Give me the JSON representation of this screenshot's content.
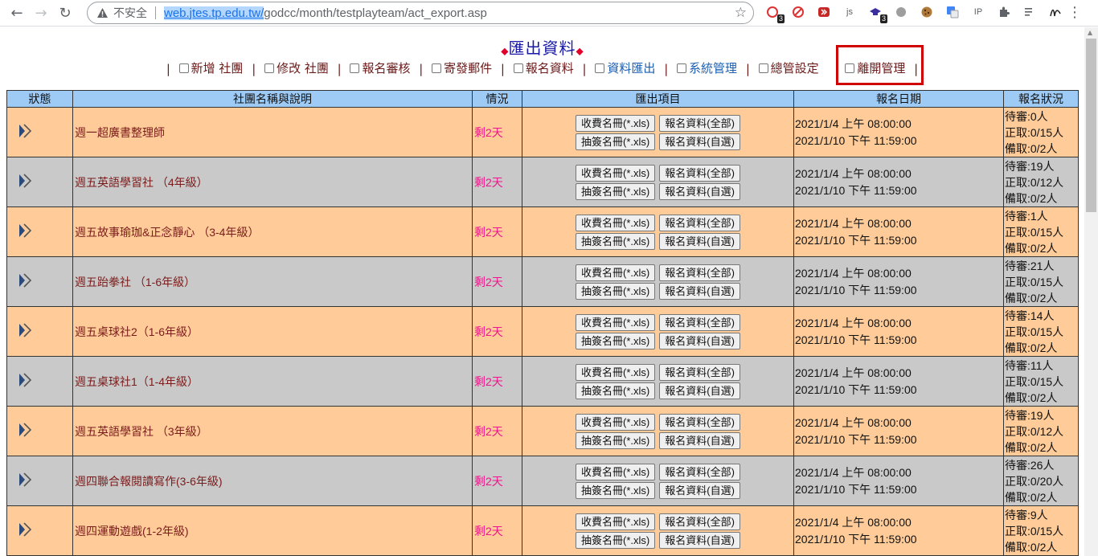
{
  "browser": {
    "insecure_label": "不安全",
    "url_host": "web.jtes.tp.edu.tw/",
    "url_path": "godcc/month/testplayteam/act_export.asp",
    "ext_badge_1": "3",
    "ext_badge_2": "3",
    "ext_js": "js",
    "ext_ip": "IP"
  },
  "page": {
    "title": "匯出資料"
  },
  "menu": [
    {
      "label": "新增 社團",
      "link": false
    },
    {
      "label": "修改 社團",
      "link": false
    },
    {
      "label": "報名審核",
      "link": false
    },
    {
      "label": "寄發郵件",
      "link": false
    },
    {
      "label": "報名資料",
      "link": false
    },
    {
      "label": "資料匯出",
      "link": true
    },
    {
      "label": "系統管理",
      "link": true
    },
    {
      "label": "總管設定",
      "link": false
    },
    {
      "label": "離開管理",
      "link": false
    }
  ],
  "table": {
    "headers": [
      "狀態",
      "社團名稱與說明",
      "情況",
      "匯出項目",
      "報名日期",
      "報名狀況"
    ],
    "buttons": {
      "fee_list": "收費名冊(*.xls)",
      "lottery_list": "抽簽名冊(*.xls)",
      "signup_all": "報名資料(全部)",
      "signup_pick": "報名資料(自選)"
    },
    "rows": [
      {
        "name": "週一超廣書整理師",
        "remain": "剩2天",
        "start": "2021/1/4 上午 08:00:00",
        "end": "2021/1/10 下午 11:59:00",
        "pending": "待審:0人",
        "admitted": "正取:0/15人",
        "waitlist": "備取:0/2人"
      },
      {
        "name": "週五英語學習社 （4年級）",
        "remain": "剩2天",
        "start": "2021/1/4 上午 08:00:00",
        "end": "2021/1/10 下午 11:59:00",
        "pending": "待審:19人",
        "admitted": "正取:0/12人",
        "waitlist": "備取:0/2人"
      },
      {
        "name": "週五故事瑜珈&正念靜心 （3-4年級）",
        "remain": "剩2天",
        "start": "2021/1/4 上午 08:00:00",
        "end": "2021/1/10 下午 11:59:00",
        "pending": "待審:1人",
        "admitted": "正取:0/15人",
        "waitlist": "備取:0/2人"
      },
      {
        "name": "週五跆拳社 （1-6年級）",
        "remain": "剩2天",
        "start": "2021/1/4 上午 08:00:00",
        "end": "2021/1/10 下午 11:59:00",
        "pending": "待審:21人",
        "admitted": "正取:0/15人",
        "waitlist": "備取:0/2人"
      },
      {
        "name": "週五桌球社2（1-6年級）",
        "remain": "剩2天",
        "start": "2021/1/4 上午 08:00:00",
        "end": "2021/1/10 下午 11:59:00",
        "pending": "待審:14人",
        "admitted": "正取:0/15人",
        "waitlist": "備取:0/2人"
      },
      {
        "name": "週五桌球社1（1-4年級）",
        "remain": "剩2天",
        "start": "2021/1/4 上午 08:00:00",
        "end": "2021/1/10 下午 11:59:00",
        "pending": "待審:11人",
        "admitted": "正取:0/15人",
        "waitlist": "備取:0/2人"
      },
      {
        "name": "週五英語學習社 （3年級）",
        "remain": "剩2天",
        "start": "2021/1/4 上午 08:00:00",
        "end": "2021/1/10 下午 11:59:00",
        "pending": "待審:19人",
        "admitted": "正取:0/12人",
        "waitlist": "備取:0/2人"
      },
      {
        "name": "週四聯合報閱讀寫作(3-6年級)",
        "remain": "剩2天",
        "start": "2021/1/4 上午 08:00:00",
        "end": "2021/1/10 下午 11:59:00",
        "pending": "待審:26人",
        "admitted": "正取:0/20人",
        "waitlist": "備取:0/2人"
      },
      {
        "name": "週四運動遊戲(1-2年級)",
        "remain": "剩2天",
        "start": "2021/1/4 上午 08:00:00",
        "end": "2021/1/10 下午 11:59:00",
        "pending": "待審:9人",
        "admitted": "正取:0/15人",
        "waitlist": "備取:0/2人"
      }
    ]
  },
  "colors": {
    "row_odd": "#ffcc99",
    "row_even": "#c9c9c9",
    "header_bg": "#9ecbf5",
    "remain_text": "#f0148c",
    "name_text": "#7a1b1b",
    "highlight_box": "#d00000"
  }
}
